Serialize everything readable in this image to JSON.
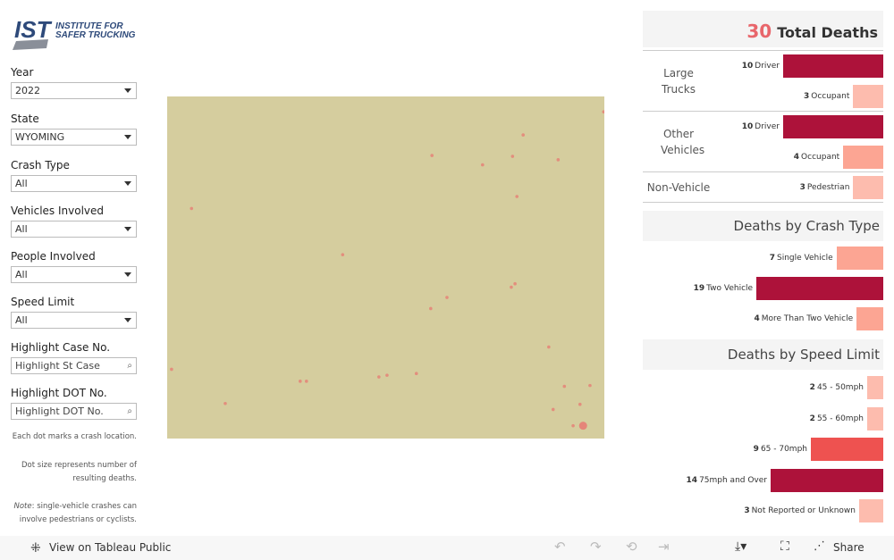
{
  "logo": {
    "text_main": "IST",
    "text_sub1": "INSTITUTE FOR",
    "text_sub2": "SAFER TRUCKING",
    "color": "#2e4a7a"
  },
  "filters": [
    {
      "label": "Year",
      "value": "2022",
      "type": "dropdown"
    },
    {
      "label": "State",
      "value": "WYOMING",
      "type": "dropdown"
    },
    {
      "label": "Crash Type",
      "value": "All",
      "type": "dropdown"
    },
    {
      "label": "Vehicles Involved",
      "value": "All",
      "type": "dropdown"
    },
    {
      "label": "People Involved",
      "value": "All",
      "type": "dropdown"
    },
    {
      "label": "Speed Limit",
      "value": "All",
      "type": "dropdown"
    },
    {
      "label": "Highlight Case No.",
      "placeholder": "Highlight St Case",
      "type": "search"
    },
    {
      "label": "Highlight DOT No.",
      "placeholder": "Highlight DOT No.",
      "type": "search"
    }
  ],
  "notes": {
    "n1": "Each dot marks a crash location.",
    "n2": "Dot size represents number of resulting deaths.",
    "n3_em": "Note",
    "n3": ": single-vehicle crashes can involve pedestrians or cyclists."
  },
  "map": {
    "fill": "#d5cd9e",
    "dot_color": "#e8736f",
    "bounds": {
      "lon": [
        -111.05,
        -104.05
      ],
      "lat": [
        41,
        45
      ]
    },
    "crashes": [
      [
        -104.06,
        44.82,
        1
      ],
      [
        -105.35,
        44.55,
        1
      ],
      [
        -106.81,
        44.31,
        1
      ],
      [
        -106.0,
        44.2,
        1
      ],
      [
        -105.52,
        44.3,
        1
      ],
      [
        -104.79,
        44.26,
        1
      ],
      [
        -105.45,
        43.83,
        1
      ],
      [
        -110.66,
        43.69,
        1
      ],
      [
        -108.24,
        43.15,
        1
      ],
      [
        -106.57,
        42.65,
        1
      ],
      [
        -106.83,
        42.52,
        1
      ],
      [
        -105.54,
        42.77,
        1
      ],
      [
        -105.48,
        42.81,
        1
      ],
      [
        -104.94,
        42.07,
        1
      ],
      [
        -110.98,
        41.81,
        1
      ],
      [
        -108.92,
        41.67,
        1
      ],
      [
        -108.82,
        41.67,
        1
      ],
      [
        -107.66,
        41.72,
        1
      ],
      [
        -107.53,
        41.74,
        1
      ],
      [
        -107.06,
        41.76,
        1
      ],
      [
        -104.69,
        41.61,
        1
      ],
      [
        -110.12,
        41.41,
        1
      ],
      [
        -104.87,
        41.34,
        1
      ],
      [
        -104.44,
        41.4,
        1
      ],
      [
        -104.55,
        41.15,
        1
      ],
      [
        -104.39,
        41.15,
        3
      ],
      [
        -104.28,
        41.62,
        1
      ]
    ]
  },
  "total": {
    "value": "30",
    "label": "Total Deaths"
  },
  "people": [
    {
      "group": "Large Trucks",
      "rows": [
        {
          "value": 10,
          "label": "Driver"
        },
        {
          "value": 3,
          "label": "Occupant"
        }
      ]
    },
    {
      "group": "Other Vehicles",
      "rows": [
        {
          "value": 10,
          "label": "Driver"
        },
        {
          "value": 4,
          "label": "Occupant"
        }
      ]
    },
    {
      "group": "Non-Vehicle",
      "rows": [
        {
          "value": 3,
          "label": "Pedestrian"
        }
      ]
    }
  ],
  "crash_type": {
    "title": "Deaths by Crash Type",
    "rows": [
      {
        "value": 7,
        "label": "Single Vehicle"
      },
      {
        "value": 19,
        "label": "Two Vehicle"
      },
      {
        "value": 4,
        "label": "More Than Two Vehicle"
      }
    ]
  },
  "speed": {
    "title": "Deaths by Speed Limit",
    "rows": [
      {
        "value": 2,
        "label": "45 - 50mph"
      },
      {
        "value": 2,
        "label": "55 - 60mph"
      },
      {
        "value": 9,
        "label": "65 - 70mph"
      },
      {
        "value": 14,
        "label": "75mph and Over"
      },
      {
        "value": 3,
        "label": "Not Reported or Unknown"
      }
    ]
  },
  "colors": {
    "dark": "#ad123a",
    "mid": "#ee5250",
    "light": "#fdbcae",
    "lightmid": "#fca593"
  },
  "footer": {
    "view": "View on Tableau Public",
    "share": "Share"
  }
}
